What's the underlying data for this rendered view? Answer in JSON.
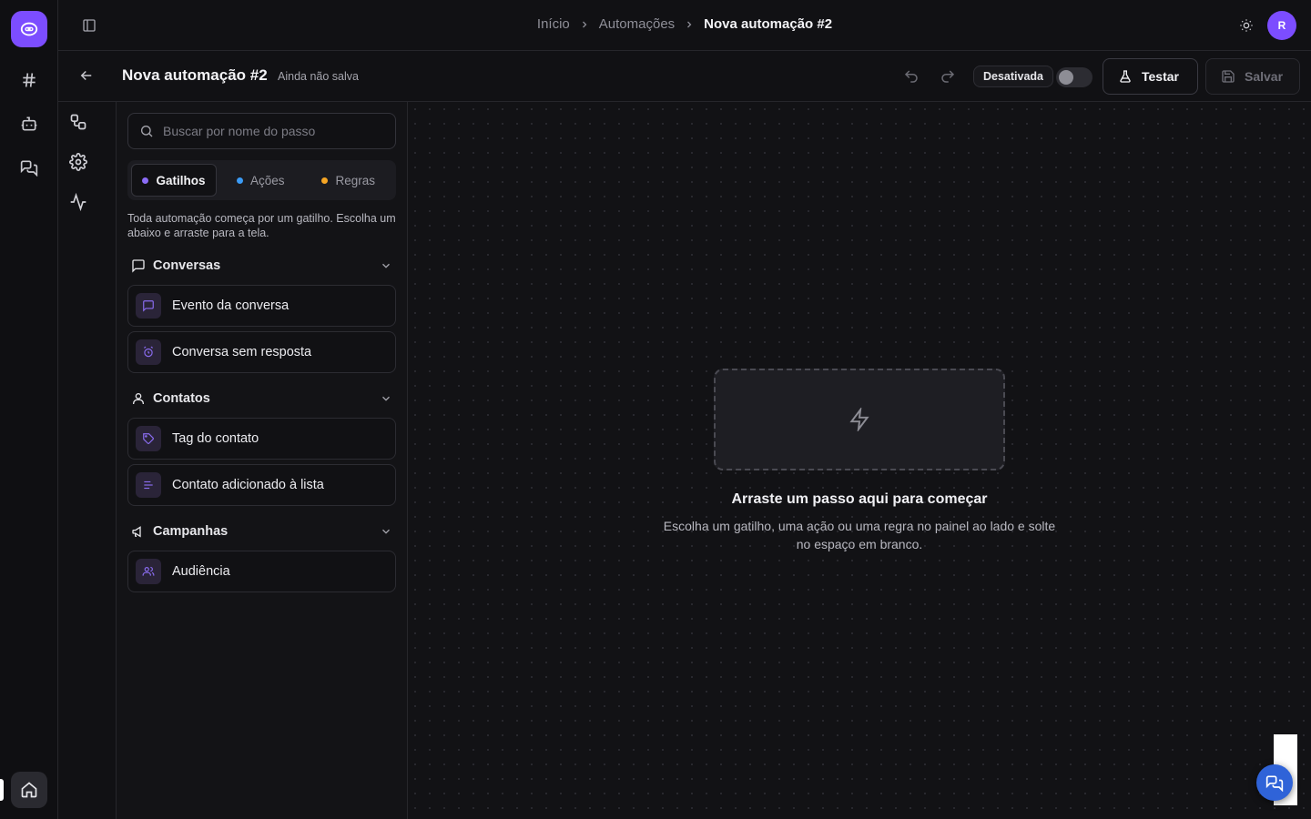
{
  "breadcrumb": {
    "home": "Início",
    "section": "Automações",
    "current": "Nova automação #2"
  },
  "user": {
    "avatar_initial": "R"
  },
  "automation": {
    "title": "Nova automação #2",
    "save_status": "Ainda não salva",
    "state_label": "Desativada",
    "enabled": false
  },
  "actions": {
    "test_label": "Testar",
    "save_label": "Salvar"
  },
  "panel": {
    "search_placeholder": "Buscar por nome do passo",
    "tabs": [
      {
        "label": "Gatilhos",
        "color": "#8b6cf6",
        "active": true
      },
      {
        "label": "Ações",
        "color": "#3b9bf5",
        "active": false
      },
      {
        "label": "Regras",
        "color": "#f5a524",
        "active": false
      }
    ],
    "help": "Toda automação começa por um gatilho. Escolha um abaixo e arraste para a tela.",
    "groups": [
      {
        "title": "Conversas",
        "icon": "message-square-icon",
        "items": [
          {
            "label": "Evento da conversa",
            "icon": "message-square-icon"
          },
          {
            "label": "Conversa sem resposta",
            "icon": "alarm-clock-icon"
          }
        ]
      },
      {
        "title": "Contatos",
        "icon": "user-icon",
        "items": [
          {
            "label": "Tag do contato",
            "icon": "tag-icon"
          },
          {
            "label": "Contato adicionado à lista",
            "icon": "list-icon"
          }
        ]
      },
      {
        "title": "Campanhas",
        "icon": "megaphone-icon",
        "items": [
          {
            "label": "Audiência",
            "icon": "users-icon"
          }
        ]
      }
    ]
  },
  "canvas": {
    "empty_title": "Arraste um passo aqui para começar",
    "empty_description": "Escolha um gatilho, uma ação ou uma regra no painel ao lado e solte no espaço em branco."
  },
  "colors": {
    "brand": "#7c4dff",
    "chat_fab": "#2f63d8",
    "background": "#111114"
  }
}
